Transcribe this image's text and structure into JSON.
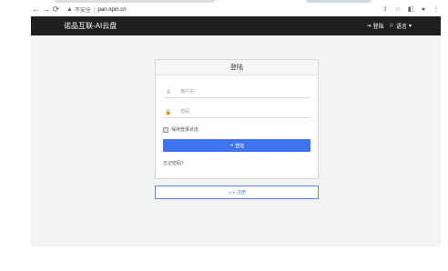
{
  "browser": {
    "security_label": "不安全",
    "url": "pan.npin.cn",
    "nav_icons": [
      "back-icon",
      "forward-icon",
      "reload-icon"
    ],
    "right_icons": [
      "share-icon",
      "star-icon",
      "sidebar-icon",
      "profile-icon",
      "menu-icon"
    ]
  },
  "header": {
    "brand": "诺品互联-AI云盘",
    "login_label": "登陆",
    "language_label": "语言"
  },
  "login_card": {
    "title": "登陆",
    "username_placeholder": "用户名",
    "password_placeholder": "密码",
    "remember_label": "保持登录状态",
    "submit_label": "登陆",
    "forgot_label": "忘记密码？"
  },
  "register": {
    "label": "注册"
  },
  "colors": {
    "header_bg": "#1f1f1f",
    "primary_button": "#3e73f2",
    "page_bg": "#f3f3f4"
  }
}
